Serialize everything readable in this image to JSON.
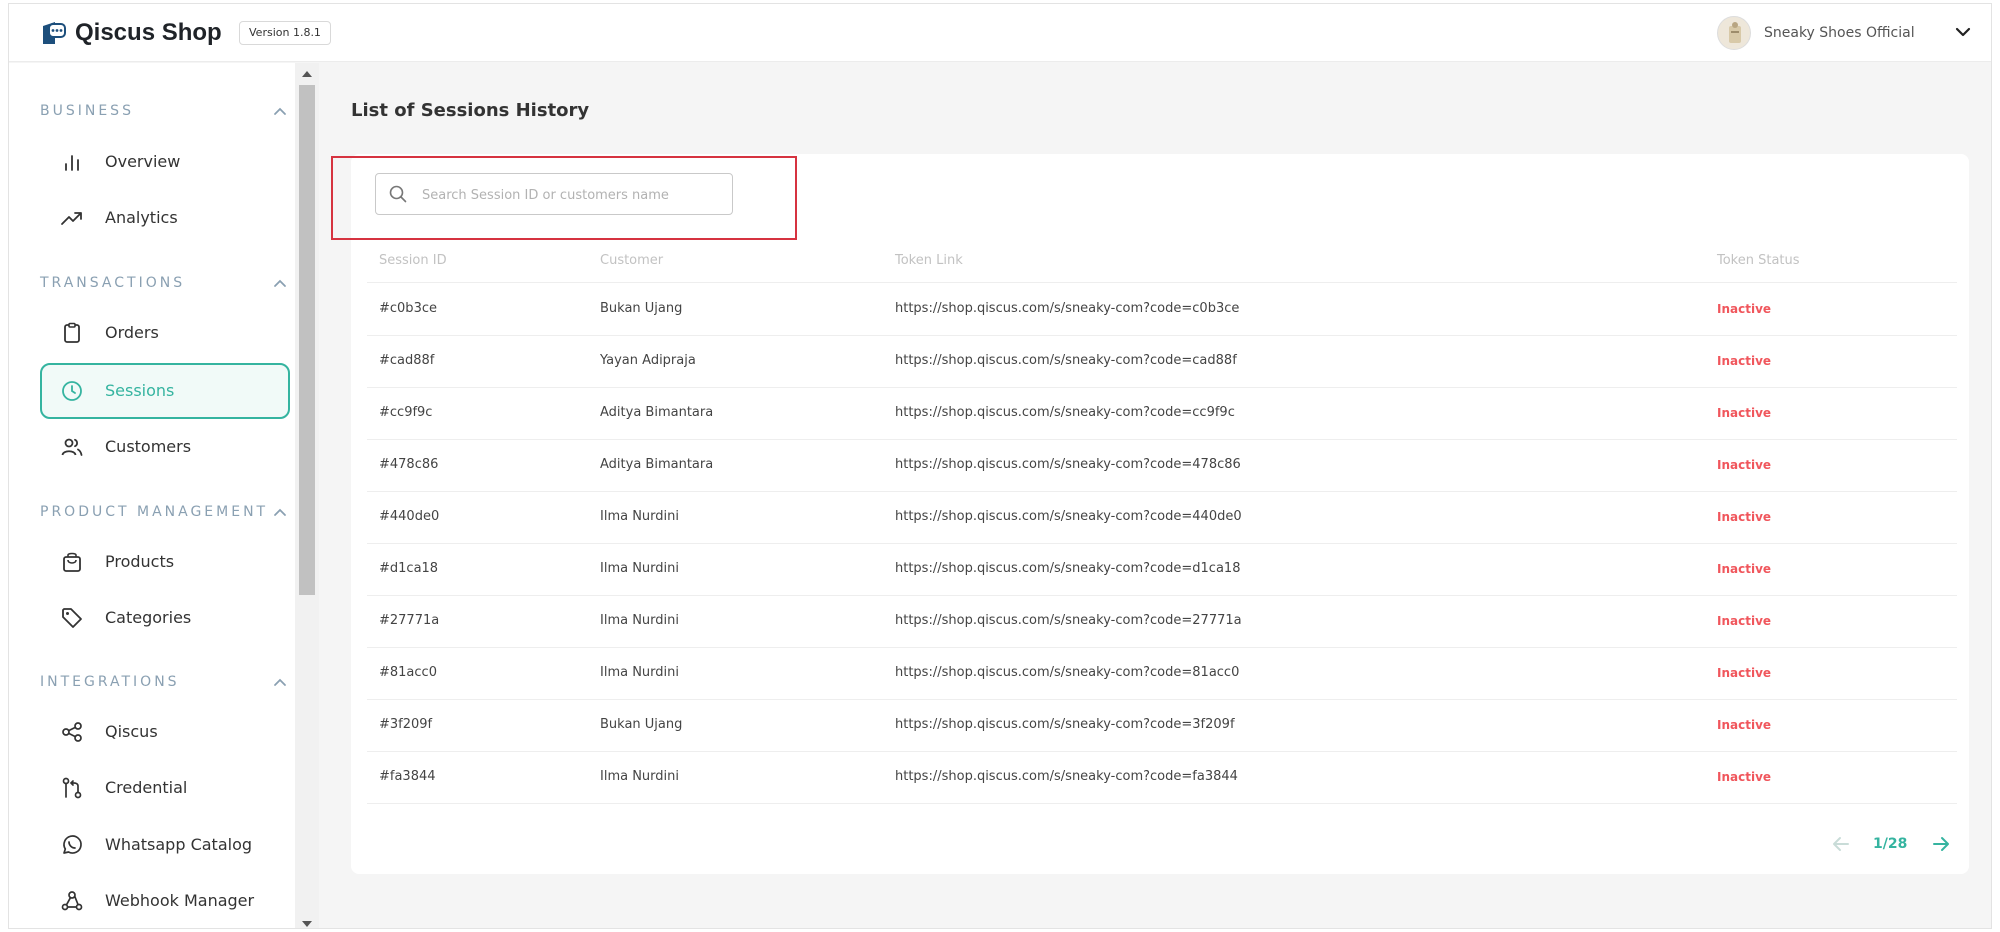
{
  "header": {
    "brand": "Qiscus Shop",
    "version": "Version 1.8.1",
    "user_name": "Sneaky Shoes Official"
  },
  "sidebar": {
    "sections": [
      {
        "title": "BUSINESS",
        "items": [
          {
            "label": "Overview",
            "icon": "bar-chart-icon"
          },
          {
            "label": "Analytics",
            "icon": "trend-up-icon"
          }
        ]
      },
      {
        "title": "TRANSACTIONS",
        "items": [
          {
            "label": "Orders",
            "icon": "clipboard-icon"
          },
          {
            "label": "Sessions",
            "icon": "clock-icon",
            "active": true
          },
          {
            "label": "Customers",
            "icon": "users-icon"
          }
        ]
      },
      {
        "title": "PRODUCT MANAGEMENT",
        "items": [
          {
            "label": "Products",
            "icon": "bag-icon"
          },
          {
            "label": "Categories",
            "icon": "tag-icon"
          }
        ]
      },
      {
        "title": "INTEGRATIONS",
        "items": [
          {
            "label": "Qiscus",
            "icon": "share-icon"
          },
          {
            "label": "Credential",
            "icon": "key-flow-icon"
          },
          {
            "label": "Whatsapp Catalog",
            "icon": "whatsapp-icon"
          },
          {
            "label": "Webhook Manager",
            "icon": "webhook-icon"
          }
        ]
      }
    ]
  },
  "main": {
    "title": "List of Sessions History",
    "search": {
      "placeholder": "Search Session ID or customers name",
      "value": ""
    },
    "columns": [
      "Session ID",
      "Customer",
      "Token Link",
      "Token Status"
    ],
    "rows": [
      {
        "id": "#c0b3ce",
        "customer": "Bukan Ujang",
        "link": "https://shop.qiscus.com/s/sneaky-com?code=c0b3ce",
        "status": "Inactive"
      },
      {
        "id": "#cad88f",
        "customer": "Yayan Adipraja",
        "link": "https://shop.qiscus.com/s/sneaky-com?code=cad88f",
        "status": "Inactive"
      },
      {
        "id": "#cc9f9c",
        "customer": "Aditya Bimantara",
        "link": "https://shop.qiscus.com/s/sneaky-com?code=cc9f9c",
        "status": "Inactive"
      },
      {
        "id": "#478c86",
        "customer": "Aditya Bimantara",
        "link": "https://shop.qiscus.com/s/sneaky-com?code=478c86",
        "status": "Inactive"
      },
      {
        "id": "#440de0",
        "customer": "Ilma Nurdini",
        "link": "https://shop.qiscus.com/s/sneaky-com?code=440de0",
        "status": "Inactive"
      },
      {
        "id": "#d1ca18",
        "customer": "Ilma Nurdini",
        "link": "https://shop.qiscus.com/s/sneaky-com?code=d1ca18",
        "status": "Inactive"
      },
      {
        "id": "#27771a",
        "customer": "Ilma Nurdini",
        "link": "https://shop.qiscus.com/s/sneaky-com?code=27771a",
        "status": "Inactive"
      },
      {
        "id": "#81acc0",
        "customer": "Ilma Nurdini",
        "link": "https://shop.qiscus.com/s/sneaky-com?code=81acc0",
        "status": "Inactive"
      },
      {
        "id": "#3f209f",
        "customer": "Bukan Ujang",
        "link": "https://shop.qiscus.com/s/sneaky-com?code=3f209f",
        "status": "Inactive"
      },
      {
        "id": "#fa3844",
        "customer": "Ilma Nurdini",
        "link": "https://shop.qiscus.com/s/sneaky-com?code=fa3844",
        "status": "Inactive"
      }
    ],
    "pagination": {
      "text": "1/28"
    }
  },
  "colors": {
    "accent": "#35b4a0",
    "inactive": "#f0565c",
    "highlight": "#d63340"
  }
}
